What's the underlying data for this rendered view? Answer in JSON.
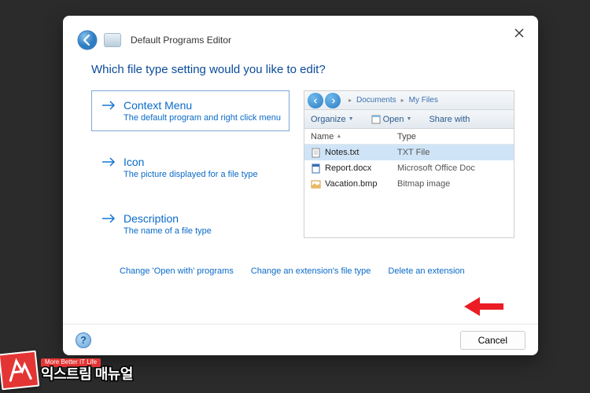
{
  "header": {
    "app_title": "Default Programs Editor"
  },
  "content": {
    "question": "Which file type setting would you like to edit?",
    "options": [
      {
        "title": "Context Menu",
        "desc": "The default program and right click menu",
        "selected": true
      },
      {
        "title": "Icon",
        "desc": "The picture displayed for a file type",
        "selected": false
      },
      {
        "title": "Description",
        "desc": "The name of a file type",
        "selected": false
      }
    ]
  },
  "preview": {
    "breadcrumbs": [
      "Documents",
      "My Files"
    ],
    "toolbar": {
      "organize": "Organize",
      "open": "Open",
      "share": "Share with"
    },
    "columns": {
      "name": "Name",
      "type": "Type"
    },
    "rows": [
      {
        "name": "Notes.txt",
        "type": "TXT File",
        "icon": "text",
        "selected": true
      },
      {
        "name": "Report.docx",
        "type": "Microsoft Office Doc",
        "icon": "word",
        "selected": false
      },
      {
        "name": "Vacation.bmp",
        "type": "Bitmap image",
        "icon": "image",
        "selected": false
      }
    ]
  },
  "links": {
    "change_openwith": "Change 'Open with' programs",
    "change_ext": "Change an extension's file type",
    "delete_ext": "Delete an extension"
  },
  "footer": {
    "cancel": "Cancel"
  },
  "watermark": {
    "sub": "More Better IT Life",
    "main": "익스트림 매뉴얼"
  }
}
